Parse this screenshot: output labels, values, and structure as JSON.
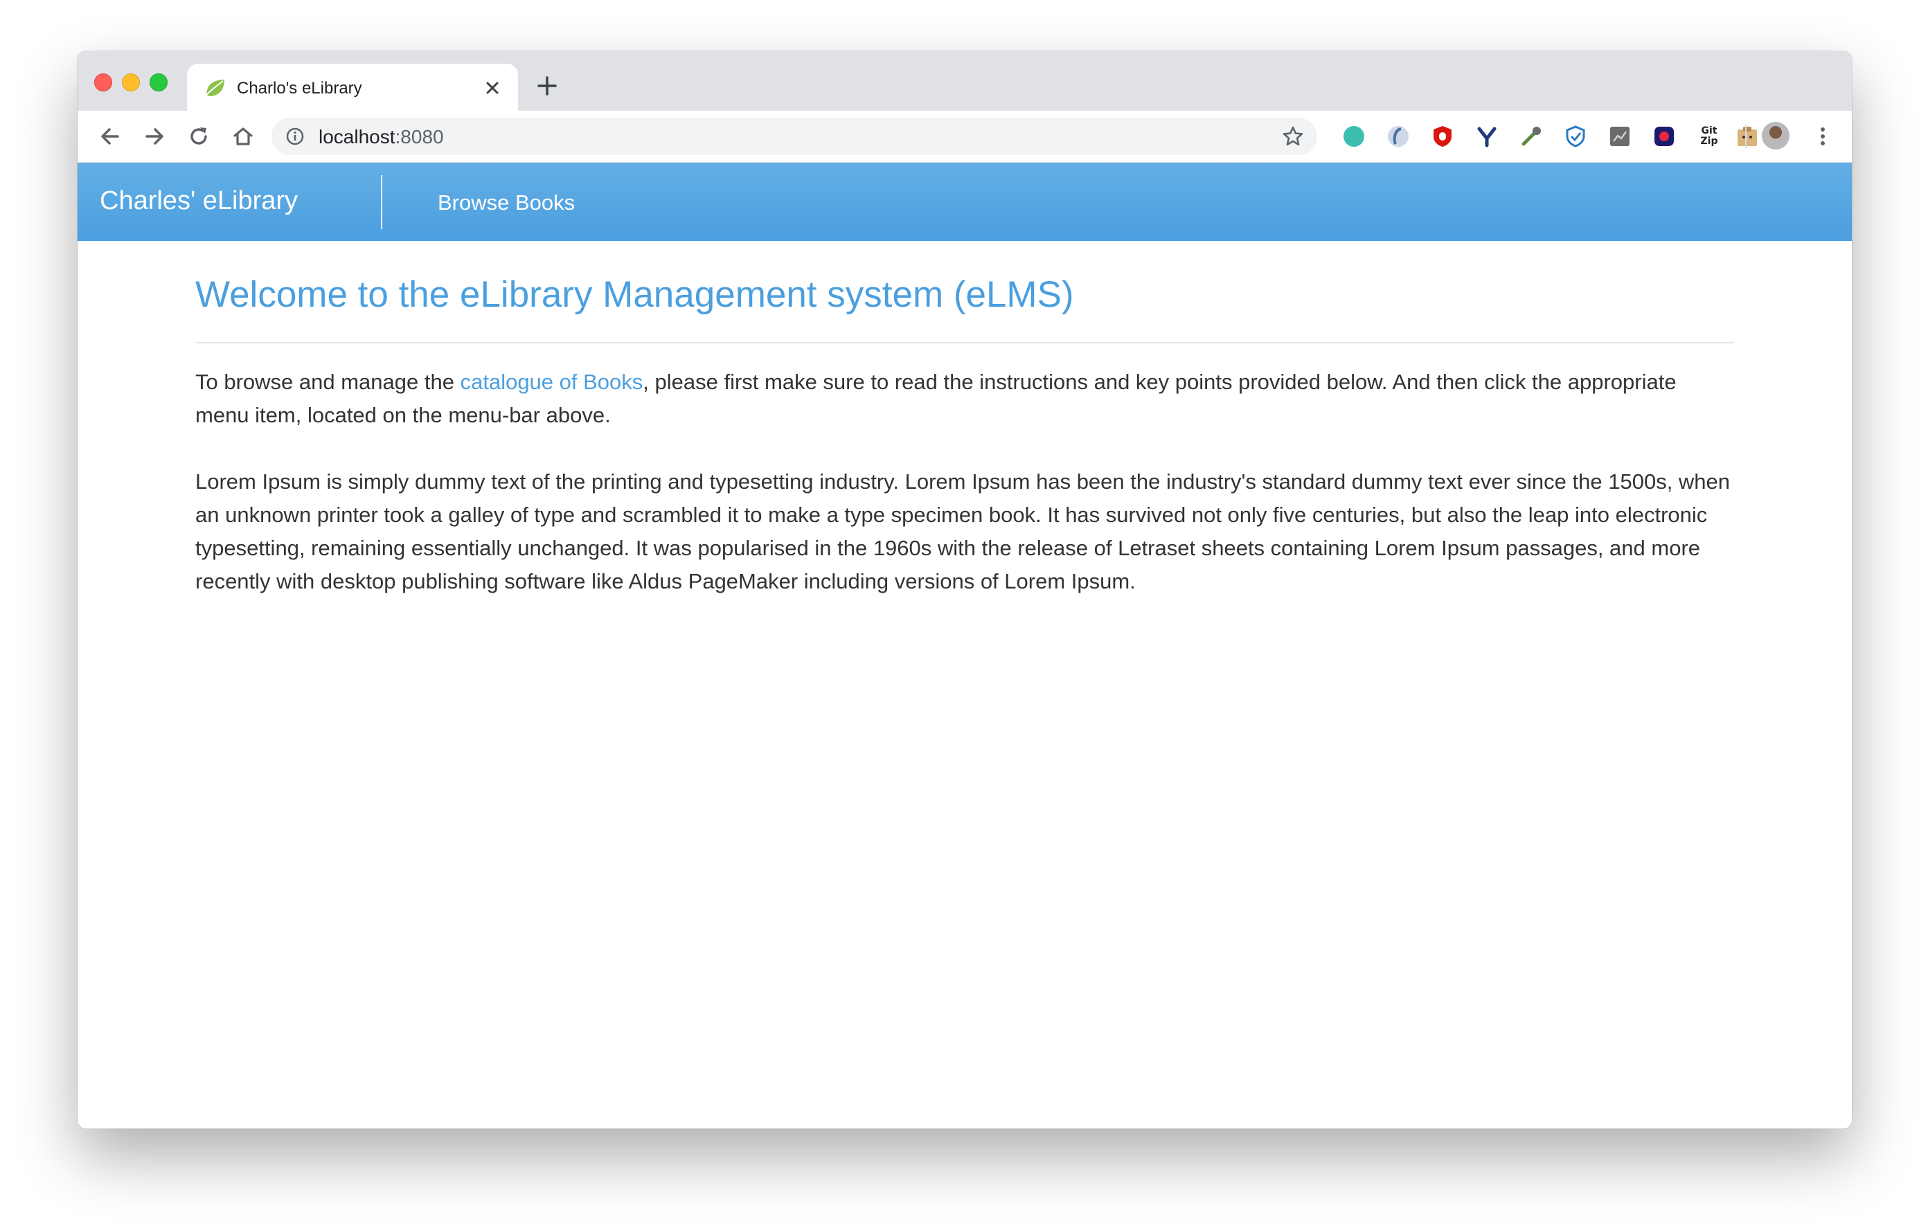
{
  "browser": {
    "tab": {
      "title": "Charlo's eLibrary"
    },
    "address_bar": {
      "host": "localhost",
      "port": ":8080"
    }
  },
  "navbar": {
    "brand": "Charles' eLibrary",
    "links": [
      {
        "label": "Browse Books"
      }
    ]
  },
  "main": {
    "title": "Welcome to the eLibrary Management system (eLMS)",
    "intro": {
      "before_link": "To browse and manage the ",
      "link_text": "catalogue of Books",
      "after_link": ", please first make sure to read the instructions and key points provided below. And then click the appropriate menu item, located on the menu-bar above."
    },
    "lorem": "Lorem Ipsum is simply dummy text of the printing and typesetting industry. Lorem Ipsum has been the industry's standard dummy text ever since the 1500s, when an unknown printer took a galley of type and scrambled it to make a type specimen book. It has survived not only five centuries, but also the leap into electronic typesetting, remaining essentially unchanged. It was popularised in the 1960s with the release of Letraset sheets containing Lorem Ipsum passages, and more recently with desktop publishing software like Aldus PageMaker including versions of Lorem Ipsum."
  },
  "extensions": [
    {
      "icon": "teal-circle-extension-icon"
    },
    {
      "icon": "blue-swirl-extension-icon"
    },
    {
      "icon": "ublock-shield-extension-icon"
    },
    {
      "icon": "y-extension-icon"
    },
    {
      "icon": "dropper-extension-icon"
    },
    {
      "icon": "shield-check-extension-icon"
    },
    {
      "icon": "chart-extension-icon"
    },
    {
      "icon": "dark-square-extension-icon"
    },
    {
      "label": "Git Zip",
      "icon": "gitzip-extension-icon"
    },
    {
      "icon": "tan-box-extension-icon"
    },
    {
      "icon": "bulb-extension-icon"
    }
  ],
  "colors": {
    "accent": "#4b9fdf",
    "navbar_top": "#63afe4",
    "navbar_bottom": "#4b9ee0",
    "body_text": "#333333"
  }
}
